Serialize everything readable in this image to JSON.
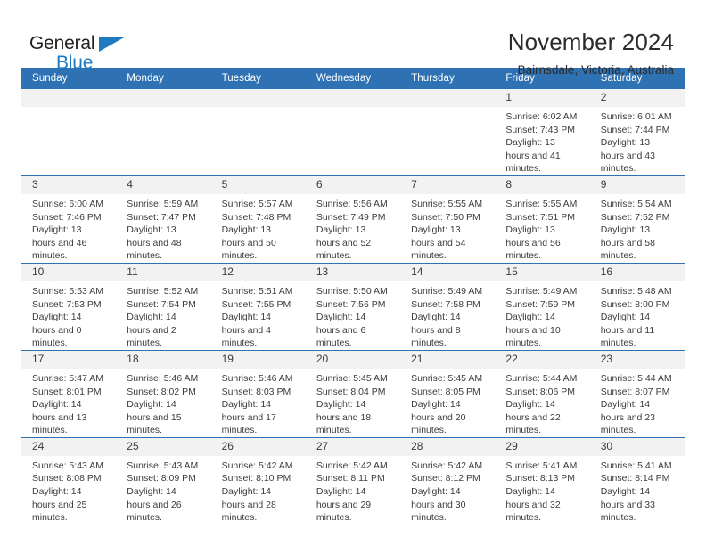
{
  "logo": {
    "word_one": "General",
    "word_two": "Blue",
    "accent_color": "#1f7ac0",
    "triangle_icon": "blue-triangle-icon"
  },
  "header": {
    "title": "November 2024",
    "location": "Bairnsdale, Victoria, Australia",
    "header_color": "#2f72b4"
  },
  "weekday_headers": [
    "Sunday",
    "Monday",
    "Tuesday",
    "Wednesday",
    "Thursday",
    "Friday",
    "Saturday"
  ],
  "labels": {
    "sunrise": "Sunrise:",
    "sunset": "Sunset:",
    "daylight": "Daylight:"
  },
  "weeks": [
    [
      {
        "day": ""
      },
      {
        "day": ""
      },
      {
        "day": ""
      },
      {
        "day": ""
      },
      {
        "day": ""
      },
      {
        "day": "1",
        "sunrise": "Sunrise: 6:02 AM",
        "sunset": "Sunset: 7:43 PM",
        "daylight": "Daylight: 13 hours and 41 minutes."
      },
      {
        "day": "2",
        "sunrise": "Sunrise: 6:01 AM",
        "sunset": "Sunset: 7:44 PM",
        "daylight": "Daylight: 13 hours and 43 minutes."
      }
    ],
    [
      {
        "day": "3",
        "sunrise": "Sunrise: 6:00 AM",
        "sunset": "Sunset: 7:46 PM",
        "daylight": "Daylight: 13 hours and 46 minutes."
      },
      {
        "day": "4",
        "sunrise": "Sunrise: 5:59 AM",
        "sunset": "Sunset: 7:47 PM",
        "daylight": "Daylight: 13 hours and 48 minutes."
      },
      {
        "day": "5",
        "sunrise": "Sunrise: 5:57 AM",
        "sunset": "Sunset: 7:48 PM",
        "daylight": "Daylight: 13 hours and 50 minutes."
      },
      {
        "day": "6",
        "sunrise": "Sunrise: 5:56 AM",
        "sunset": "Sunset: 7:49 PM",
        "daylight": "Daylight: 13 hours and 52 minutes."
      },
      {
        "day": "7",
        "sunrise": "Sunrise: 5:55 AM",
        "sunset": "Sunset: 7:50 PM",
        "daylight": "Daylight: 13 hours and 54 minutes."
      },
      {
        "day": "8",
        "sunrise": "Sunrise: 5:55 AM",
        "sunset": "Sunset: 7:51 PM",
        "daylight": "Daylight: 13 hours and 56 minutes."
      },
      {
        "day": "9",
        "sunrise": "Sunrise: 5:54 AM",
        "sunset": "Sunset: 7:52 PM",
        "daylight": "Daylight: 13 hours and 58 minutes."
      }
    ],
    [
      {
        "day": "10",
        "sunrise": "Sunrise: 5:53 AM",
        "sunset": "Sunset: 7:53 PM",
        "daylight": "Daylight: 14 hours and 0 minutes."
      },
      {
        "day": "11",
        "sunrise": "Sunrise: 5:52 AM",
        "sunset": "Sunset: 7:54 PM",
        "daylight": "Daylight: 14 hours and 2 minutes."
      },
      {
        "day": "12",
        "sunrise": "Sunrise: 5:51 AM",
        "sunset": "Sunset: 7:55 PM",
        "daylight": "Daylight: 14 hours and 4 minutes."
      },
      {
        "day": "13",
        "sunrise": "Sunrise: 5:50 AM",
        "sunset": "Sunset: 7:56 PM",
        "daylight": "Daylight: 14 hours and 6 minutes."
      },
      {
        "day": "14",
        "sunrise": "Sunrise: 5:49 AM",
        "sunset": "Sunset: 7:58 PM",
        "daylight": "Daylight: 14 hours and 8 minutes."
      },
      {
        "day": "15",
        "sunrise": "Sunrise: 5:49 AM",
        "sunset": "Sunset: 7:59 PM",
        "daylight": "Daylight: 14 hours and 10 minutes."
      },
      {
        "day": "16",
        "sunrise": "Sunrise: 5:48 AM",
        "sunset": "Sunset: 8:00 PM",
        "daylight": "Daylight: 14 hours and 11 minutes."
      }
    ],
    [
      {
        "day": "17",
        "sunrise": "Sunrise: 5:47 AM",
        "sunset": "Sunset: 8:01 PM",
        "daylight": "Daylight: 14 hours and 13 minutes."
      },
      {
        "day": "18",
        "sunrise": "Sunrise: 5:46 AM",
        "sunset": "Sunset: 8:02 PM",
        "daylight": "Daylight: 14 hours and 15 minutes."
      },
      {
        "day": "19",
        "sunrise": "Sunrise: 5:46 AM",
        "sunset": "Sunset: 8:03 PM",
        "daylight": "Daylight: 14 hours and 17 minutes."
      },
      {
        "day": "20",
        "sunrise": "Sunrise: 5:45 AM",
        "sunset": "Sunset: 8:04 PM",
        "daylight": "Daylight: 14 hours and 18 minutes."
      },
      {
        "day": "21",
        "sunrise": "Sunrise: 5:45 AM",
        "sunset": "Sunset: 8:05 PM",
        "daylight": "Daylight: 14 hours and 20 minutes."
      },
      {
        "day": "22",
        "sunrise": "Sunrise: 5:44 AM",
        "sunset": "Sunset: 8:06 PM",
        "daylight": "Daylight: 14 hours and 22 minutes."
      },
      {
        "day": "23",
        "sunrise": "Sunrise: 5:44 AM",
        "sunset": "Sunset: 8:07 PM",
        "daylight": "Daylight: 14 hours and 23 minutes."
      }
    ],
    [
      {
        "day": "24",
        "sunrise": "Sunrise: 5:43 AM",
        "sunset": "Sunset: 8:08 PM",
        "daylight": "Daylight: 14 hours and 25 minutes."
      },
      {
        "day": "25",
        "sunrise": "Sunrise: 5:43 AM",
        "sunset": "Sunset: 8:09 PM",
        "daylight": "Daylight: 14 hours and 26 minutes."
      },
      {
        "day": "26",
        "sunrise": "Sunrise: 5:42 AM",
        "sunset": "Sunset: 8:10 PM",
        "daylight": "Daylight: 14 hours and 28 minutes."
      },
      {
        "day": "27",
        "sunrise": "Sunrise: 5:42 AM",
        "sunset": "Sunset: 8:11 PM",
        "daylight": "Daylight: 14 hours and 29 minutes."
      },
      {
        "day": "28",
        "sunrise": "Sunrise: 5:42 AM",
        "sunset": "Sunset: 8:12 PM",
        "daylight": "Daylight: 14 hours and 30 minutes."
      },
      {
        "day": "29",
        "sunrise": "Sunrise: 5:41 AM",
        "sunset": "Sunset: 8:13 PM",
        "daylight": "Daylight: 14 hours and 32 minutes."
      },
      {
        "day": "30",
        "sunrise": "Sunrise: 5:41 AM",
        "sunset": "Sunset: 8:14 PM",
        "daylight": "Daylight: 14 hours and 33 minutes."
      }
    ]
  ]
}
